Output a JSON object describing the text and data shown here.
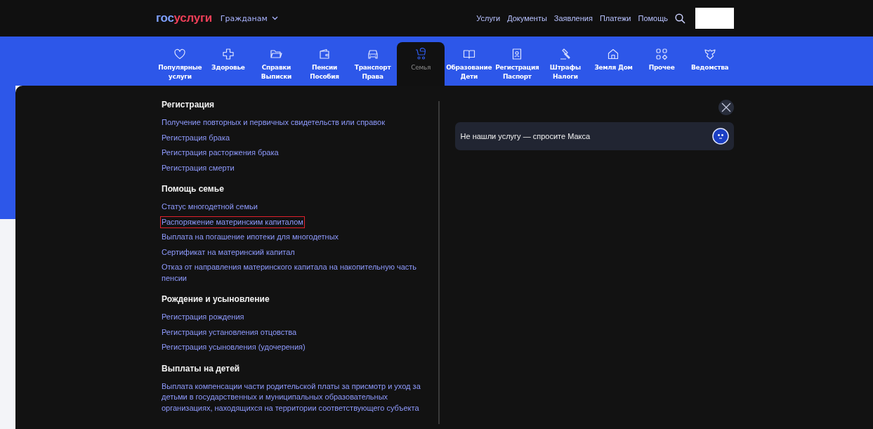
{
  "header": {
    "logo": [
      "гос",
      "услуги"
    ],
    "audience_menu": "Гражданам",
    "links": [
      "Услуги",
      "Документы",
      "Заявления",
      "Платежи",
      "Помощь"
    ]
  },
  "categories": [
    {
      "label": "Популярные\nуслуги",
      "selected": false
    },
    {
      "label": "Здоровье",
      "selected": false
    },
    {
      "label": "Справки\nВыписки",
      "selected": false
    },
    {
      "label": "Пенсии\nПособия",
      "selected": false
    },
    {
      "label": "Транспорт\nПрава",
      "selected": false
    },
    {
      "label": "Семья",
      "selected": true
    },
    {
      "label": "Образование\nДети",
      "selected": false
    },
    {
      "label": "Регистрация\nПаспорт",
      "selected": false
    },
    {
      "label": "Штрафы\nНалоги",
      "selected": false
    },
    {
      "label": "Земля Дом",
      "selected": false
    },
    {
      "label": "Прочее",
      "selected": false
    },
    {
      "label": "Ведомства",
      "selected": false
    }
  ],
  "sections": [
    {
      "title": "Регистрация",
      "items": [
        {
          "label": "Получение повторных и первичных свидетельств или справок",
          "highlighted": false
        },
        {
          "label": "Регистрация брака",
          "highlighted": false
        },
        {
          "label": "Регистрация расторжения брака",
          "highlighted": false
        },
        {
          "label": "Регистрация смерти",
          "highlighted": false
        }
      ]
    },
    {
      "title": "Помощь семье",
      "items": [
        {
          "label": "Статус многодетной семьи",
          "highlighted": false
        },
        {
          "label": "Распоряжение материнским капиталом",
          "highlighted": true
        },
        {
          "label": "Выплата на погашение ипотеки для многодетных",
          "highlighted": false
        },
        {
          "label": "Сертификат на материнский капитал",
          "highlighted": false
        },
        {
          "label": "Отказ от направления материнского капитала на накопительную часть пенсии",
          "highlighted": false
        }
      ]
    },
    {
      "title": "Рождение и усыновление",
      "items": [
        {
          "label": "Регистрация рождения",
          "highlighted": false
        },
        {
          "label": "Регистрация установления отцовства",
          "highlighted": false
        },
        {
          "label": "Регистрация усыновления (удочерения)",
          "highlighted": false
        }
      ]
    },
    {
      "title": "Выплаты на детей",
      "items": [
        {
          "label": "Выплата компенсации части родительской платы за присмотр и уход за детьми в государственных и муниципальных образовательных организациях, находящихся на территории соответствующего субъекта",
          "highlighted": false
        }
      ]
    }
  ],
  "assistant": {
    "prompt": "Не нашли услугу — спросите Макса"
  }
}
